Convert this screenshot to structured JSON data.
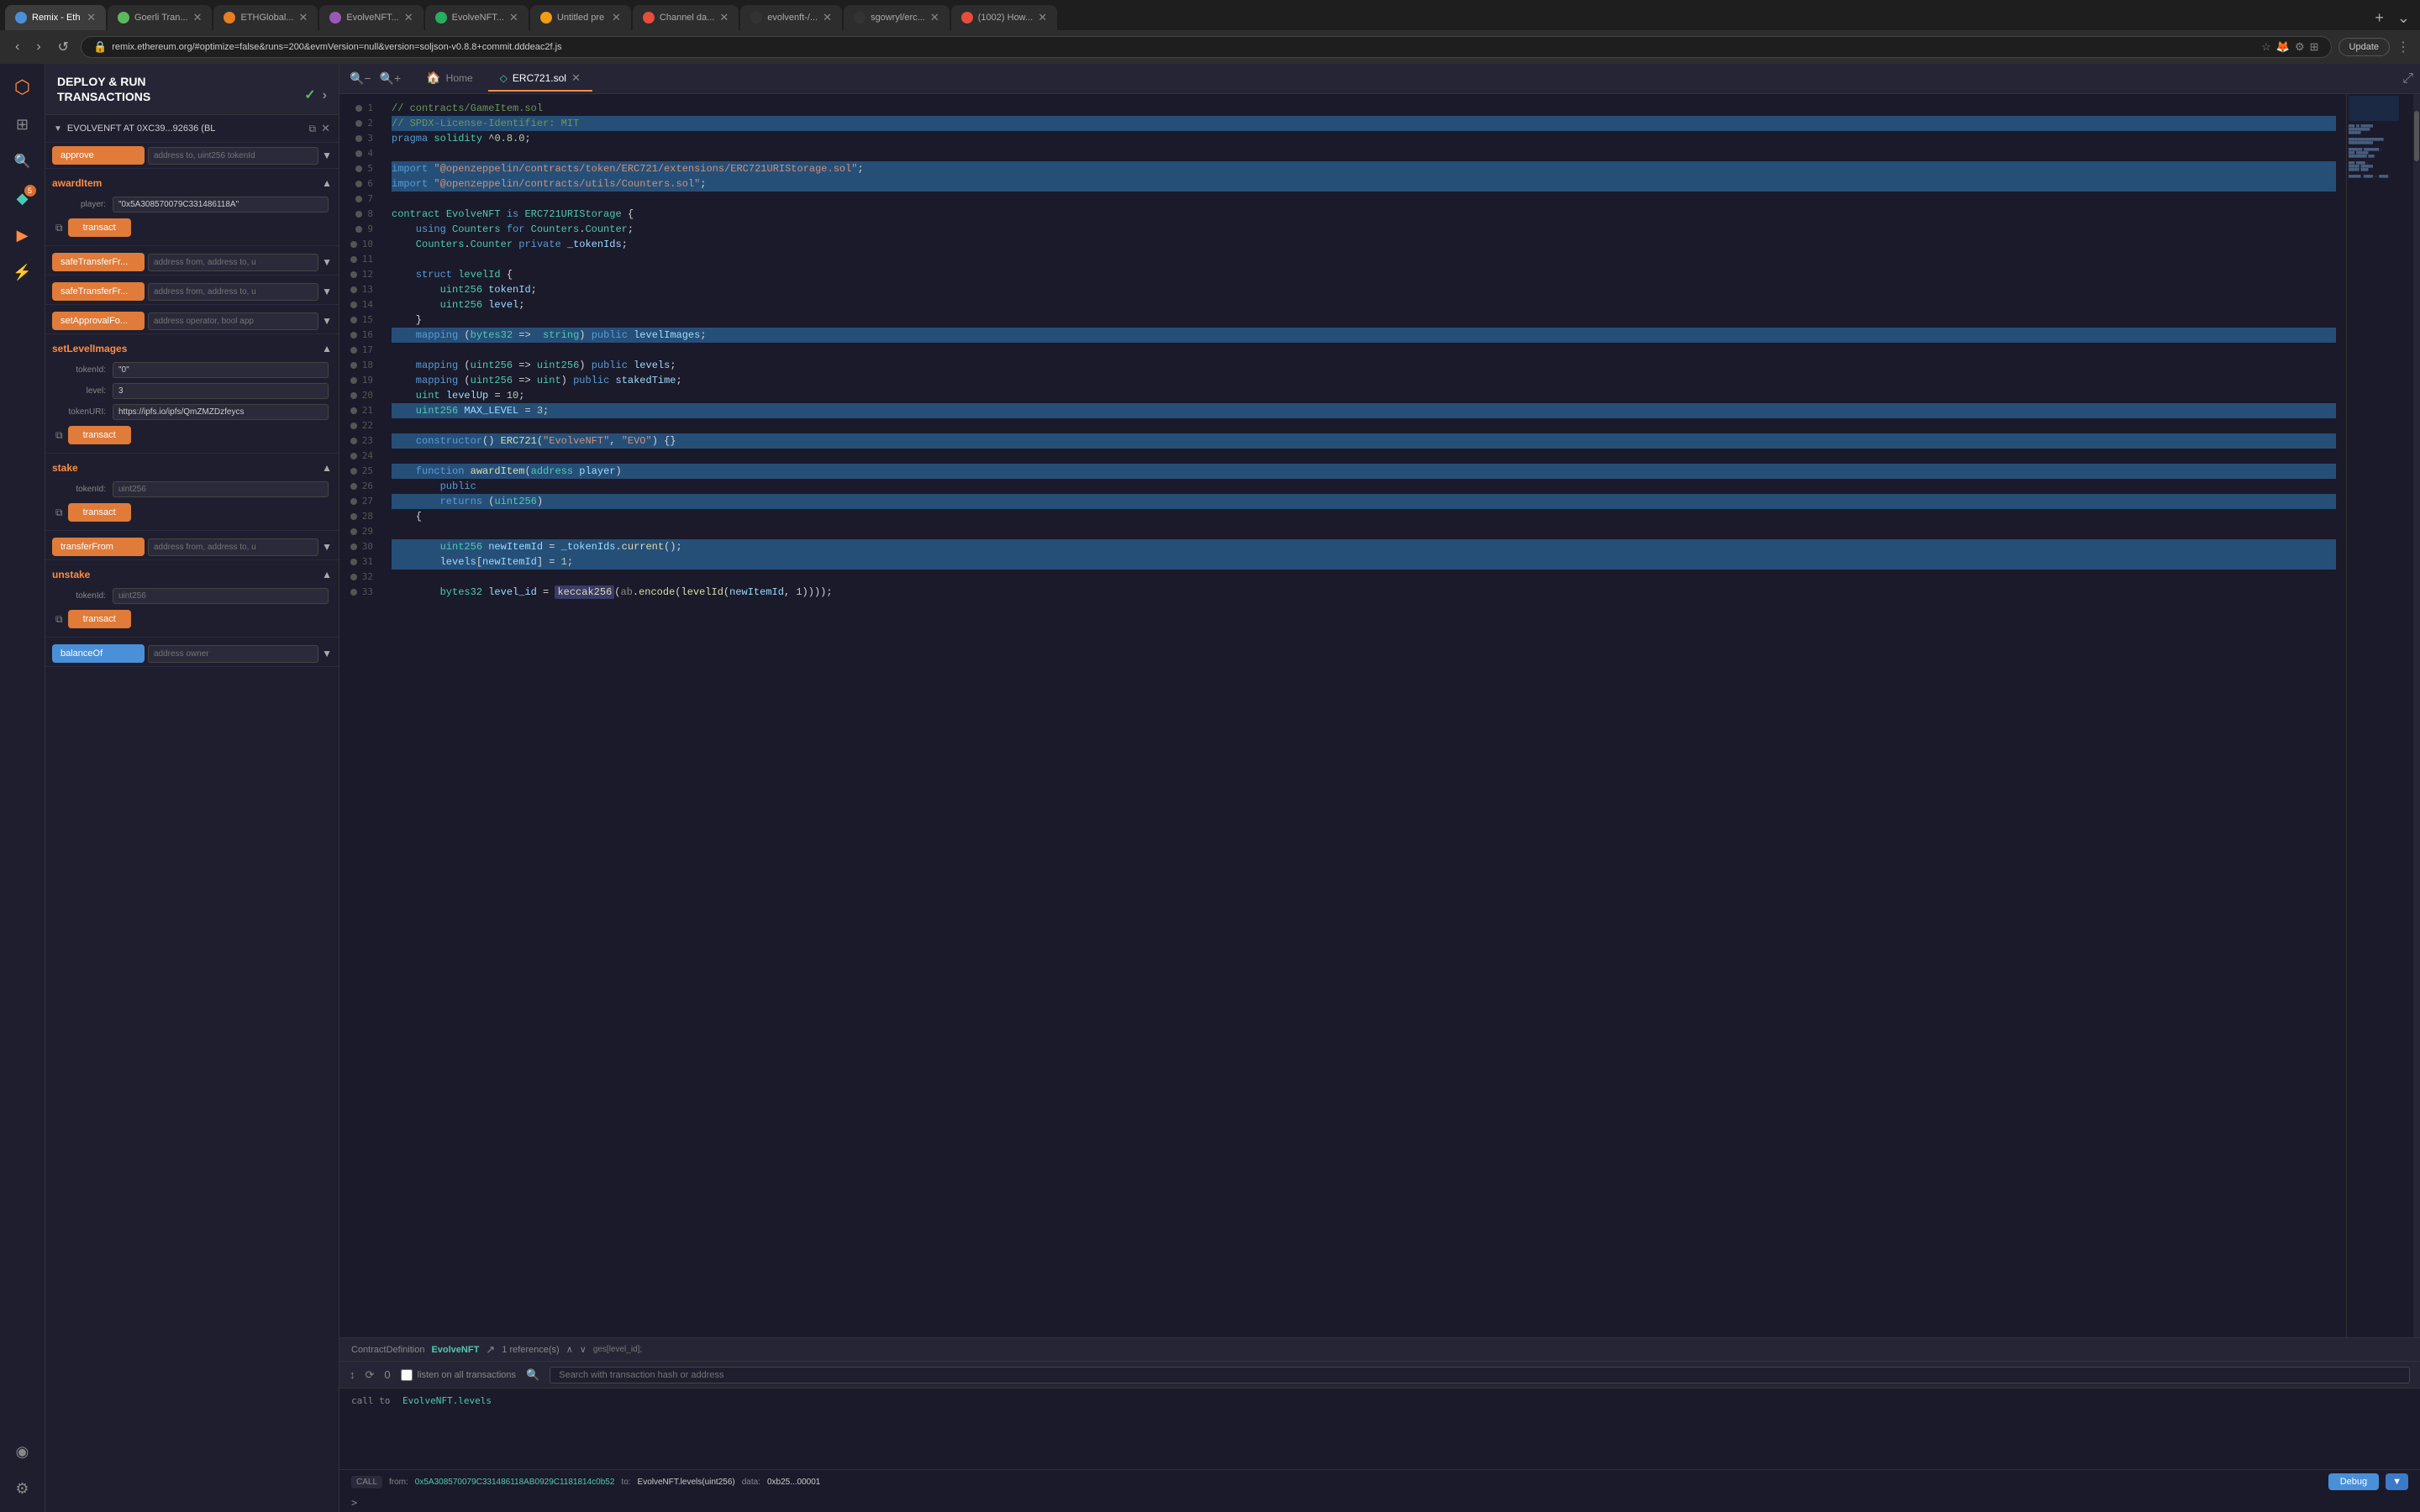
{
  "browser": {
    "url": "remix.ethereum.org/#optimize=false&runs=200&evmVersion=null&version=soljson-v0.8.8+commit.dddeac2f.js",
    "update_label": "Update",
    "tabs": [
      {
        "id": "remix",
        "title": "Remix - Eth",
        "favicon_color": "#4a90d9",
        "active": true
      },
      {
        "id": "goerli",
        "title": "Goerli Tran...",
        "favicon_color": "#5cb85c",
        "active": false
      },
      {
        "id": "ethglobal",
        "title": "ETHGlobal...",
        "favicon_color": "#e67e22",
        "active": false
      },
      {
        "id": "evolvnft1",
        "title": "EvolveNFT...",
        "favicon_color": "#9b59b6",
        "active": false
      },
      {
        "id": "evolvnft2",
        "title": "EvolveNFT...",
        "favicon_color": "#27ae60",
        "active": false
      },
      {
        "id": "untitled",
        "title": "Untitled pre",
        "favicon_color": "#f39c12",
        "active": false
      },
      {
        "id": "channel",
        "title": "Channel da...",
        "favicon_color": "#e74c3c",
        "active": false
      },
      {
        "id": "evolvenft-gh",
        "title": "evolvenft-/...",
        "favicon_color": "#333",
        "active": false
      },
      {
        "id": "sgowryl",
        "title": "sgowryl/erc...",
        "favicon_color": "#333",
        "active": false
      },
      {
        "id": "how",
        "title": "(1002) How...",
        "favicon_color": "#e74c3c",
        "active": false
      }
    ]
  },
  "sidebar": {
    "icons": [
      {
        "id": "remix-logo",
        "symbol": "⬡",
        "active": true
      },
      {
        "id": "files",
        "symbol": "⊞",
        "active": false
      },
      {
        "id": "search",
        "symbol": "🔍",
        "active": false
      },
      {
        "id": "solidity",
        "symbol": "◆",
        "active": false,
        "badge": "5"
      },
      {
        "id": "deploy",
        "symbol": "▶",
        "active": true
      },
      {
        "id": "debug",
        "symbol": "⚡",
        "active": false
      },
      {
        "id": "plugins",
        "symbol": "◉",
        "active": false
      },
      {
        "id": "settings",
        "symbol": "⚙",
        "active": false
      }
    ]
  },
  "deploy_panel": {
    "title": "DEPLOY & RUN\nTRANSACTIONS",
    "contract_address": "EVOLVENFT AT 0XC39...92636 (BL",
    "functions": {
      "approve": {
        "label": "approve",
        "placeholder": "address to, uint256 tokenId"
      },
      "awardItem": {
        "label": "awardItem",
        "fields": [
          {
            "label": "player:",
            "value": "\"0x5A308570079C331486118A\"",
            "placeholder": ""
          }
        ],
        "transact": "transact"
      },
      "safeTransferFr1": {
        "label": "safeTransferFr...",
        "placeholder": "address from, address to, u"
      },
      "safeTransferFr2": {
        "label": "safeTransferFr...",
        "placeholder": "address from, address to, u"
      },
      "setApprovalFo": {
        "label": "setApprovalFo...",
        "placeholder": "address operator, bool app"
      },
      "setLevelImages": {
        "label": "setLevelImages",
        "fields": [
          {
            "label": "tokenId:",
            "value": "\"0\"",
            "placeholder": ""
          },
          {
            "label": "level:",
            "value": "3",
            "placeholder": ""
          },
          {
            "label": "tokenURI:",
            "value": "https://ipfs.io/ipfs/QmZMZDzfeycs",
            "placeholder": ""
          }
        ],
        "transact": "transact"
      },
      "stake": {
        "label": "stake",
        "fields": [
          {
            "label": "tokenId:",
            "value": "",
            "placeholder": "uint256"
          }
        ],
        "transact": "transact"
      },
      "transferFrom": {
        "label": "transferFrom",
        "placeholder": "address from, address to, u"
      },
      "unstake": {
        "label": "unstake",
        "fields": [
          {
            "label": "tokenId:",
            "value": "",
            "placeholder": "uint256"
          }
        ],
        "transact": "transact"
      },
      "balanceOf": {
        "label": "balanceOf",
        "placeholder": "address owner"
      }
    }
  },
  "editor": {
    "home_tab": "Home",
    "file_tab": "ERC721.sol",
    "lines": [
      {
        "num": 1,
        "code": "// contracts/GameItem.sol",
        "type": "comment"
      },
      {
        "num": 2,
        "code": "// SPDX-License-Identifier: MIT",
        "type": "comment-highlighted"
      },
      {
        "num": 3,
        "code": "pragma solidity ^0.8.0;",
        "type": "pragma"
      },
      {
        "num": 4,
        "code": "",
        "type": "empty"
      },
      {
        "num": 5,
        "code": "import \"@openzeppelin/contracts/token/ERC721/extensions/ERC721URIStorage.sol\";",
        "type": "import-highlighted"
      },
      {
        "num": 6,
        "code": "import \"@openzeppelin/contracts/utils/Counters.sol\";",
        "type": "import-highlighted"
      },
      {
        "num": 7,
        "code": "",
        "type": "empty"
      },
      {
        "num": 8,
        "code": "contract EvolveNFT is ERC721URIStorage {",
        "type": "contract"
      },
      {
        "num": 9,
        "code": "    using Counters for Counters.Counter;",
        "type": "code"
      },
      {
        "num": 10,
        "code": "    Counters.Counter private _tokenIds;",
        "type": "code"
      },
      {
        "num": 11,
        "code": "",
        "type": "empty"
      },
      {
        "num": 12,
        "code": "    struct levelId {",
        "type": "code"
      },
      {
        "num": 13,
        "code": "        uint256 tokenId;",
        "type": "code"
      },
      {
        "num": 14,
        "code": "        uint256 level;",
        "type": "code"
      },
      {
        "num": 15,
        "code": "    }",
        "type": "code"
      },
      {
        "num": 16,
        "code": "    mapping (bytes32 =>  string) public levelImages;",
        "type": "code-highlighted"
      },
      {
        "num": 17,
        "code": "",
        "type": "empty"
      },
      {
        "num": 18,
        "code": "    mapping (uint256 => uint256) public levels;",
        "type": "code"
      },
      {
        "num": 19,
        "code": "    mapping (uint256 => uint) public stakedTime;",
        "type": "code"
      },
      {
        "num": 20,
        "code": "    uint levelUp = 10;",
        "type": "code"
      },
      {
        "num": 21,
        "code": "    uint256 MAX_LEVEL = 3;",
        "type": "code-highlighted"
      },
      {
        "num": 22,
        "code": "",
        "type": "empty"
      },
      {
        "num": 23,
        "code": "    constructor() ERC721(\"EvolveNFT\", \"EVO\") {}",
        "type": "code-highlighted"
      },
      {
        "num": 24,
        "code": "",
        "type": "empty"
      },
      {
        "num": 25,
        "code": "    function awardItem(address player)",
        "type": "code-highlighted"
      },
      {
        "num": 26,
        "code": "        public",
        "type": "code"
      },
      {
        "num": 27,
        "code": "        returns (uint256)",
        "type": "code-highlighted"
      },
      {
        "num": 28,
        "code": "    {",
        "type": "code"
      },
      {
        "num": 29,
        "code": "",
        "type": "empty"
      },
      {
        "num": 30,
        "code": "        uint256 newItemId = _tokenIds.current();",
        "type": "code-highlighted"
      },
      {
        "num": 31,
        "code": "        levels[newItemId] = 1;",
        "type": "code-highlighted"
      },
      {
        "num": 32,
        "code": "",
        "type": "empty"
      },
      {
        "num": 33,
        "code": "        bytes32 level_id = keccak256(ab.encode(levelId(newItemId, 1)));",
        "type": "code"
      }
    ],
    "reference_bar": {
      "definition": "ContractDefinition",
      "name": "EvolveNFT",
      "reference_count": "1 reference(s)"
    }
  },
  "bottom_panel": {
    "icons": [
      "↓↑",
      "⟳",
      "0"
    ],
    "listen_label": "listen on all transactions",
    "search_placeholder": "Search with transaction hash or address",
    "console_lines": [
      {
        "label": "call to",
        "text": "EvolveNFT.levels"
      },
      {
        "label": "CALL",
        "text": ""
      },
      {
        "from_label": "from:",
        "from": "0x5A308570079C331486118AB0929C1181814c0b52",
        "to_label": "to:",
        "to": "EvolveNFT.levels(uint256)",
        "data_label": "data:",
        "data": "0xb25...00001"
      }
    ],
    "debug_label": "Debug",
    "prompt": ">"
  },
  "colors": {
    "accent": "#e07b39",
    "blue": "#4a90d9",
    "green": "#27ae60",
    "bg_dark": "#1a1a2a",
    "bg_panel": "#1e1e2e",
    "border": "#333"
  }
}
